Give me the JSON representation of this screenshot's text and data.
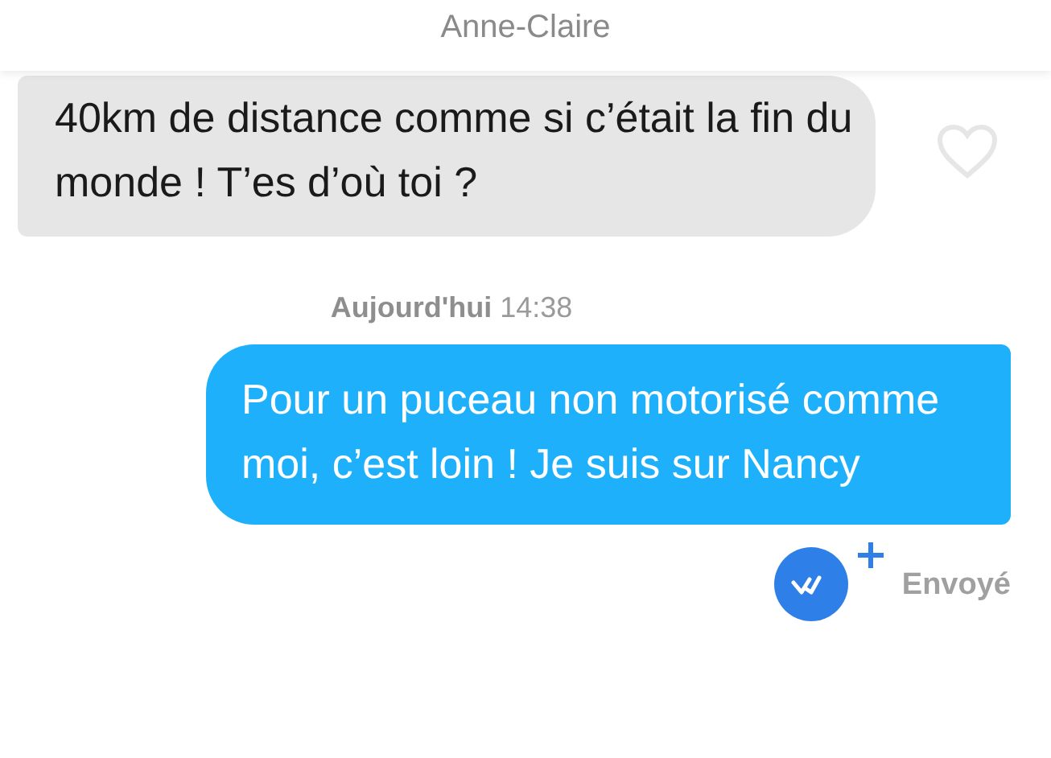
{
  "header": {
    "title": "Anne-Claire"
  },
  "messages": [
    {
      "kind": "received",
      "text": "40km de distance comme si c’était la fin du monde ! T’es d’où toi ?"
    },
    {
      "kind": "timestamp",
      "text": "**Aujourd'hui** 14:38"
    },
    {
      "kind": "sent",
      "text": "Pour un puceau non motorisé comme moi, c’est loin ! Je suis sur Nancy"
    }
  ],
  "status": {
    "label": "Envoyé"
  }
}
